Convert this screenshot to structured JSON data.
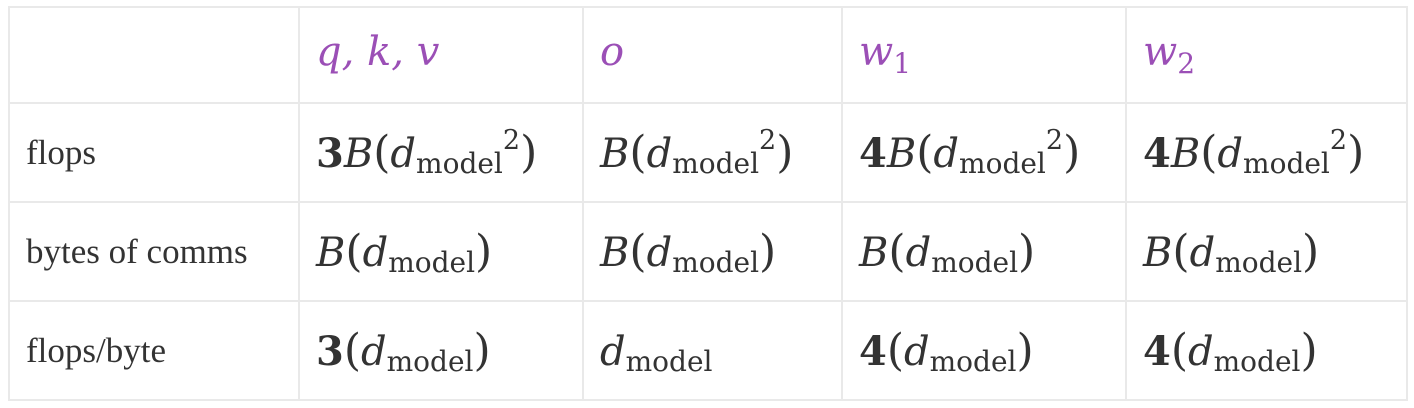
{
  "table": {
    "corner": "",
    "columns": [
      {
        "main": "q, k, v",
        "sub": ""
      },
      {
        "main": "o",
        "sub": ""
      },
      {
        "main": "w",
        "sub": "1"
      },
      {
        "main": "w",
        "sub": "2"
      }
    ],
    "rows": [
      {
        "label": "flops",
        "cells": [
          {
            "coef": "3",
            "var": "B",
            "open": "(",
            "d": "d",
            "sub": "model",
            "sup": "2",
            "close": ")"
          },
          {
            "coef": "",
            "var": "B",
            "open": "(",
            "d": "d",
            "sub": "model",
            "sup": "2",
            "close": ")"
          },
          {
            "coef": "4",
            "var": "B",
            "open": "(",
            "d": "d",
            "sub": "model",
            "sup": "2",
            "close": ")"
          },
          {
            "coef": "4",
            "var": "B",
            "open": "(",
            "d": "d",
            "sub": "model",
            "sup": "2",
            "close": ")"
          }
        ]
      },
      {
        "label": "bytes of comms",
        "cells": [
          {
            "coef": "",
            "var": "B",
            "open": "(",
            "d": "d",
            "sub": "model",
            "sup": "",
            "close": ")"
          },
          {
            "coef": "",
            "var": "B",
            "open": "(",
            "d": "d",
            "sub": "model",
            "sup": "",
            "close": ")"
          },
          {
            "coef": "",
            "var": "B",
            "open": "(",
            "d": "d",
            "sub": "model",
            "sup": "",
            "close": ")"
          },
          {
            "coef": "",
            "var": "B",
            "open": "(",
            "d": "d",
            "sub": "model",
            "sup": "",
            "close": ")"
          }
        ]
      },
      {
        "label": "flops/byte",
        "cells": [
          {
            "coef": "3",
            "var": "",
            "open": "(",
            "d": "d",
            "sub": "model",
            "sup": "",
            "close": ")"
          },
          {
            "coef": "",
            "var": "",
            "open": "",
            "d": "d",
            "sub": "model",
            "sup": "",
            "close": ""
          },
          {
            "coef": "4",
            "var": "",
            "open": "(",
            "d": "d",
            "sub": "model",
            "sup": "",
            "close": ")"
          },
          {
            "coef": "4",
            "var": "",
            "open": "(",
            "d": "d",
            "sub": "model",
            "sup": "",
            "close": ")"
          }
        ]
      }
    ]
  },
  "colors": {
    "header_text": "#9b4fb6",
    "body_text": "#333333",
    "grid_lines": "#e9e9e9"
  }
}
